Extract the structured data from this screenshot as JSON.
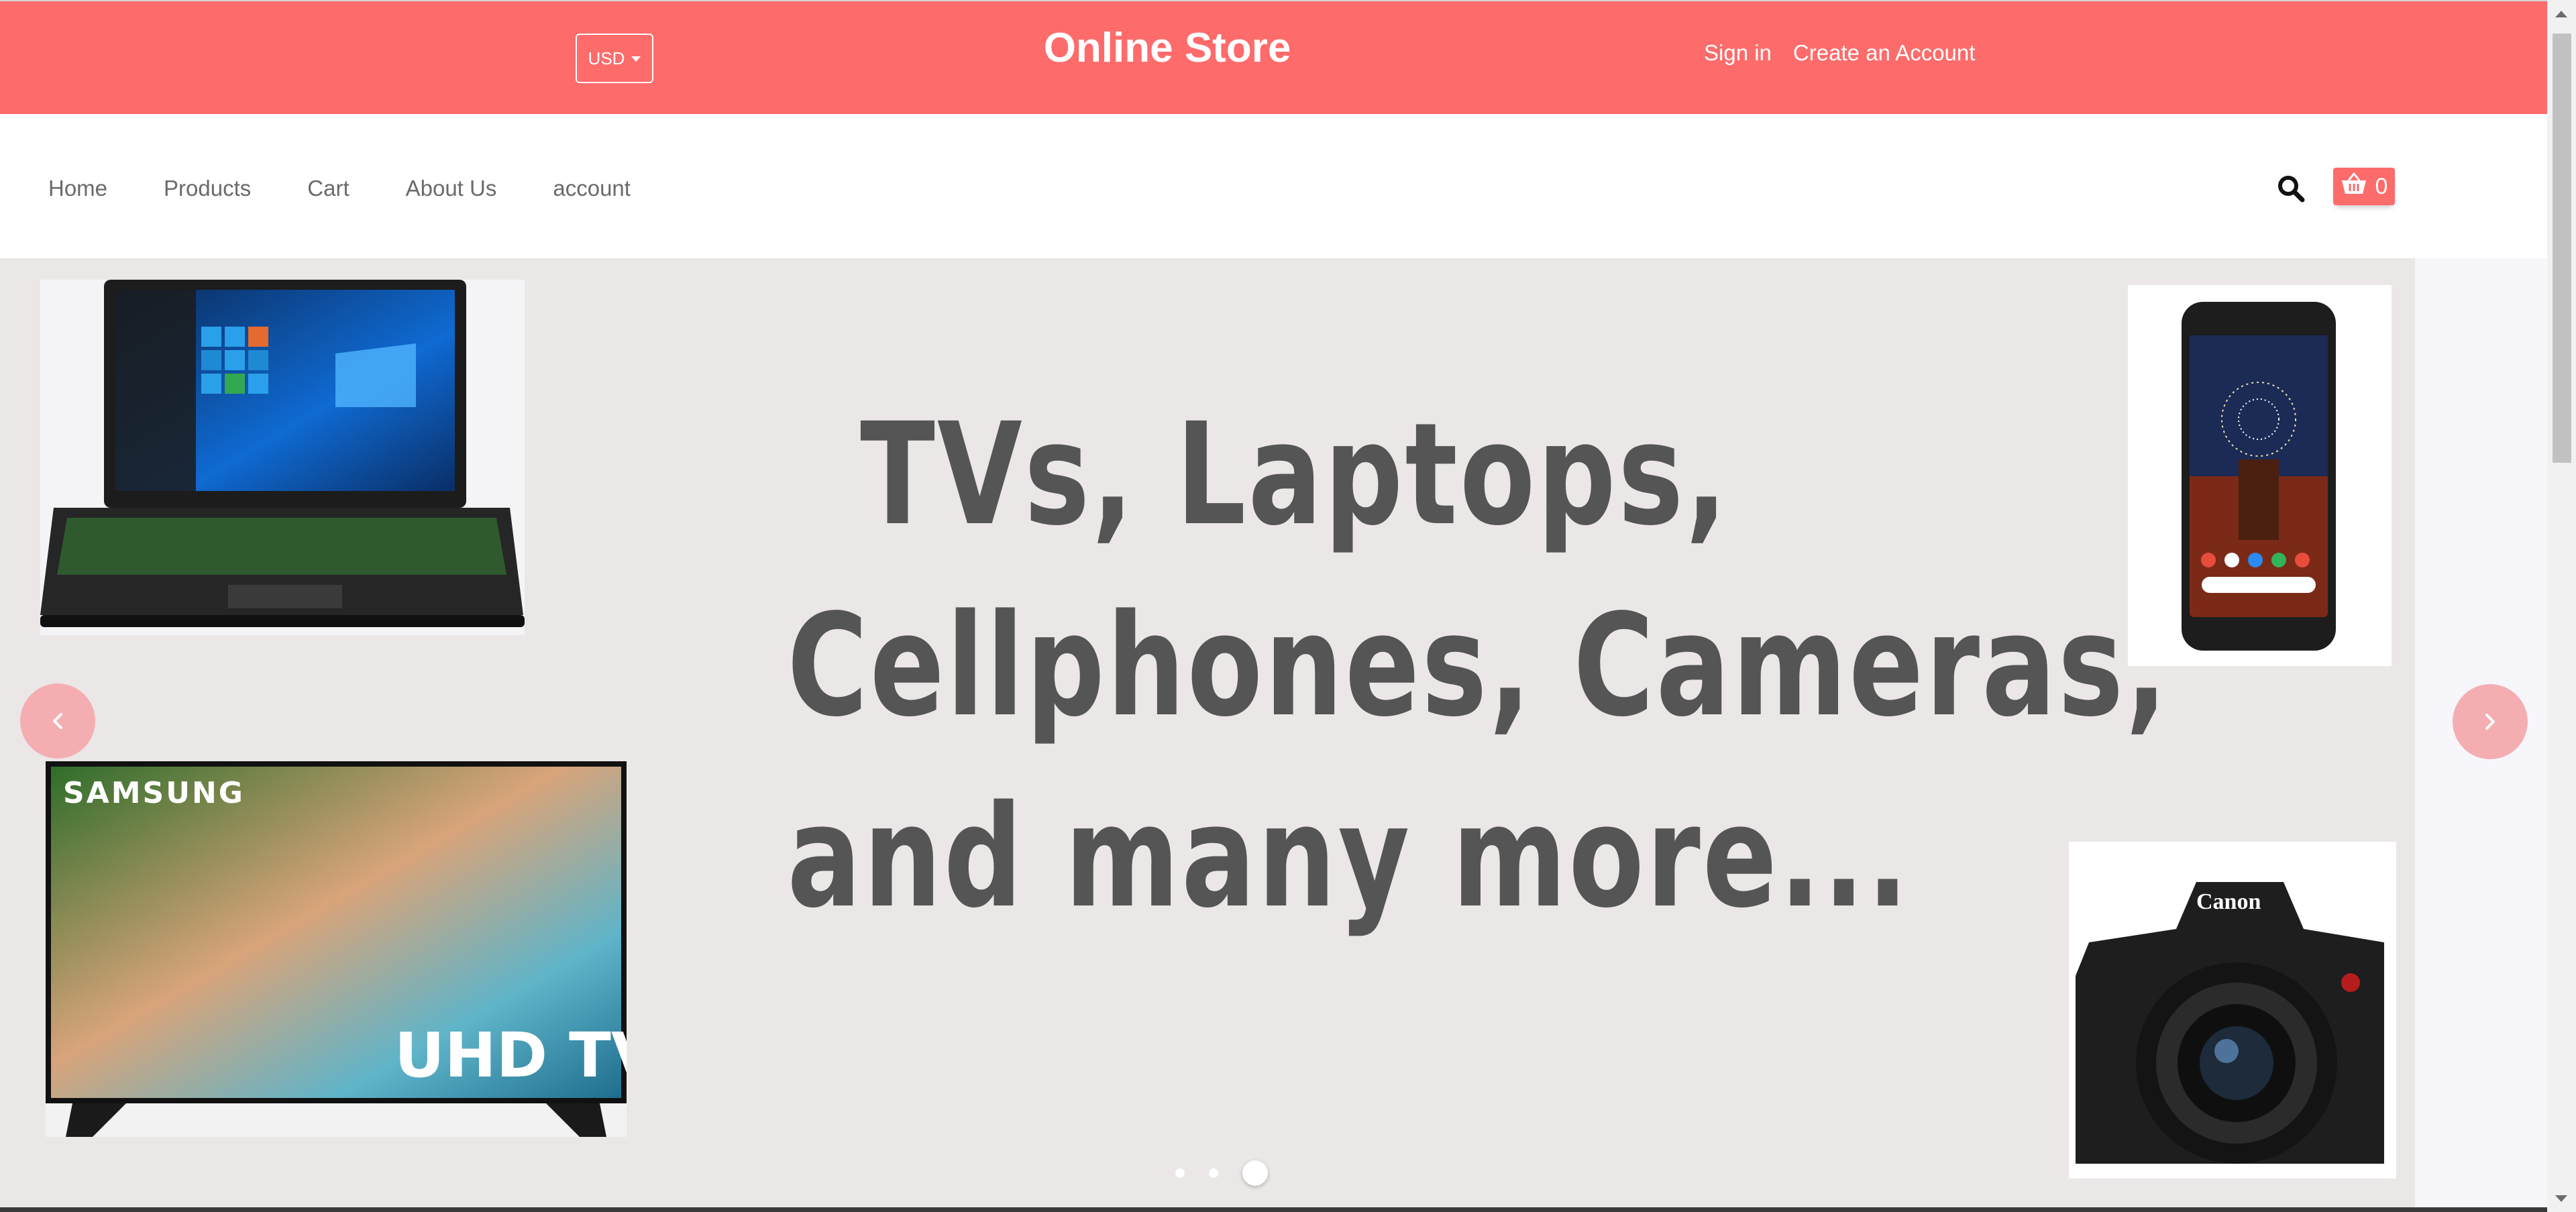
{
  "header": {
    "currency": "USD",
    "title": "Online Store",
    "sign_in": "Sign in",
    "create_account": "Create an Account"
  },
  "nav": {
    "items": [
      "Home",
      "Products",
      "Cart",
      "About Us",
      "account"
    ]
  },
  "cart": {
    "count": "0"
  },
  "hero": {
    "lines": [
      "TVs, Laptops,",
      "Cellphones, Cameras,",
      "and many more..."
    ],
    "tv_brand": "SAMSUNG",
    "tv_label": "UHD TV",
    "camera_brand": "Canon",
    "slides": 3,
    "active_slide": 3
  },
  "colors": {
    "brand": "#fe6b6b",
    "hero_bg": "#ebe7e6",
    "arrow_bg": "#f4aeb2",
    "hero_text": "#555555"
  },
  "icons": {
    "search": "search-icon",
    "cart": "basket-icon",
    "prev": "chevron-left-icon",
    "next": "chevron-right-icon"
  }
}
